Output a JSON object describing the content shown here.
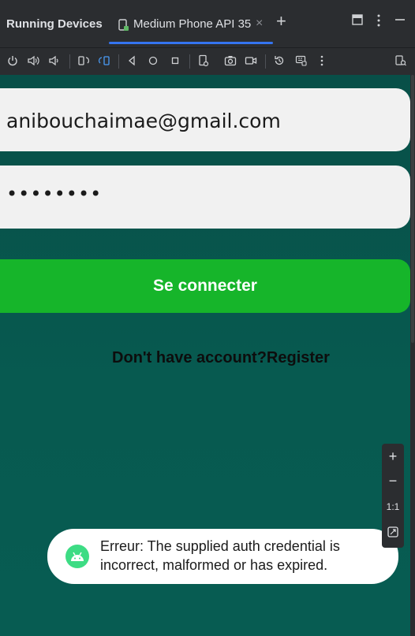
{
  "panel": {
    "title": "Running Devices"
  },
  "tab": {
    "label": "Medium Phone API 35",
    "close": "×",
    "add": "+"
  },
  "toolbar_icons": [
    "power-icon",
    "volume-up-icon",
    "volume-down-icon",
    "rotate-left-icon",
    "rotate-right-icon",
    "back-icon",
    "home-icon",
    "overview-icon",
    "device-settings-icon",
    "screenshot-icon",
    "screen-record-icon",
    "snapshot-icon",
    "keypad-icon",
    "more-icon",
    "device-explorer-icon"
  ],
  "app": {
    "email_value": "anibouchaimae@gmail.com",
    "password_value": "••••••••",
    "login_label": "Se connecter",
    "register_text": "Don't have account?Register"
  },
  "toast": {
    "message": "Erreur: The supplied auth credential is incorrect, malformed or has expired."
  },
  "zoom": {
    "plus": "+",
    "minus": "−",
    "actual": "1:1"
  },
  "colors": {
    "app_bg": "#075a50",
    "login_button": "#16b52a",
    "tab_indicator": "#3574f0",
    "android_green": "#3ddc84"
  }
}
